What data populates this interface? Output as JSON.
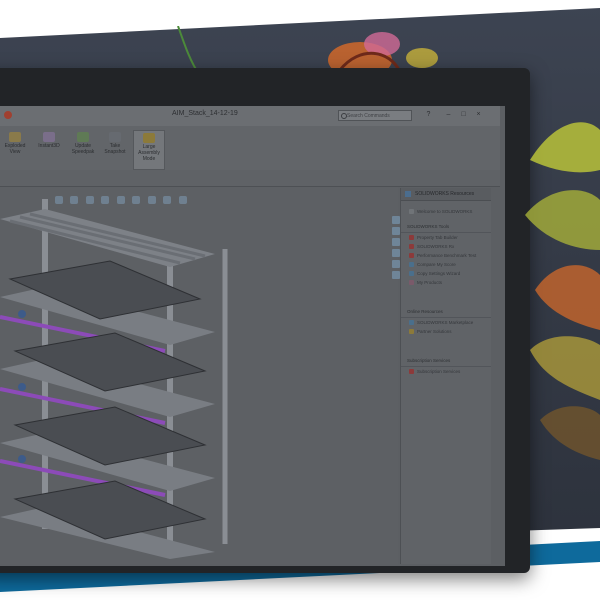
{
  "window": {
    "title": "AIM_Stack_14-12-19",
    "search_placeholder": "Search Commands"
  },
  "ribbon": {
    "buttons": [
      {
        "label": "Exploded View",
        "icon": "exploded-view-icon"
      },
      {
        "label": "Instant3D",
        "icon": "instant3d-icon"
      },
      {
        "label": "Update Speedpak",
        "icon": "update-speedpak-icon"
      },
      {
        "label": "Take Snapshot",
        "icon": "take-snapshot-icon"
      },
      {
        "label": "Large Assembly Mode",
        "icon": "large-assembly-mode-icon",
        "active": true
      }
    ]
  },
  "resources_pane": {
    "title": "SOLIDWORKS Resources",
    "welcome": "Welcome to SOLIDWORKS",
    "sections": [
      {
        "title": "SOLIDWORKS Tools",
        "items": [
          "Property Tab Builder",
          "SOLIDWORKS Rx",
          "Performance Benchmark Test",
          "Compare My Score",
          "Copy Settings Wizard",
          "My Products"
        ]
      },
      {
        "title": "Online Resources",
        "items": [
          "SOLIDWORKS Marketplace",
          "Partner Solutions"
        ]
      },
      {
        "title": "Subscription Services",
        "items": [
          "Subscription Services"
        ]
      }
    ]
  },
  "colors": {
    "brand_blue": "#0e6a9c",
    "accent_purple": "#8c4bb8",
    "leaf_yellow": "#b8c23a",
    "leaf_orange": "#c8662c"
  }
}
